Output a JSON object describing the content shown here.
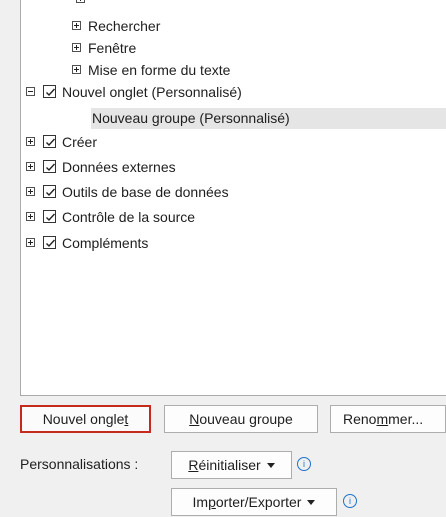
{
  "tree": {
    "items": [
      {
        "label": "Rechercher",
        "expander": "plus"
      },
      {
        "label": "Fenêtre",
        "expander": "plus"
      },
      {
        "label": "Mise en forme du texte",
        "expander": "plus"
      },
      {
        "label": "Nouvel onglet (Personnalisé)",
        "expander": "minus",
        "checked": true
      },
      {
        "label": "Nouveau groupe (Personnalisé)",
        "selected": true
      },
      {
        "label": "Créer",
        "expander": "plus",
        "checked": true
      },
      {
        "label": "Données externes",
        "expander": "plus",
        "checked": true
      },
      {
        "label": "Outils de base de données",
        "expander": "plus",
        "checked": true
      },
      {
        "label": "Contrôle de la source",
        "expander": "plus",
        "checked": true
      },
      {
        "label": "Compléments",
        "expander": "plus",
        "checked": true
      }
    ]
  },
  "buttons": {
    "new_tab": {
      "pre": "Nouvel ongle",
      "mnemonic": "t",
      "post": ""
    },
    "new_group": {
      "pre": "",
      "mnemonic": "N",
      "post": "ouveau groupe"
    },
    "rename": {
      "pre": "Reno",
      "mnemonic": "m",
      "post": "mer..."
    }
  },
  "customizations": {
    "label": "Personnalisations :",
    "reset": {
      "pre": "",
      "mnemonic": "R",
      "post": "éinitialiser"
    },
    "import_export": {
      "pre": "Im",
      "mnemonic": "p",
      "post": "orter/Exporter"
    },
    "info_glyph": "i"
  },
  "colors": {
    "primary_border": "#c42b1c",
    "info": "#1e73c9"
  }
}
